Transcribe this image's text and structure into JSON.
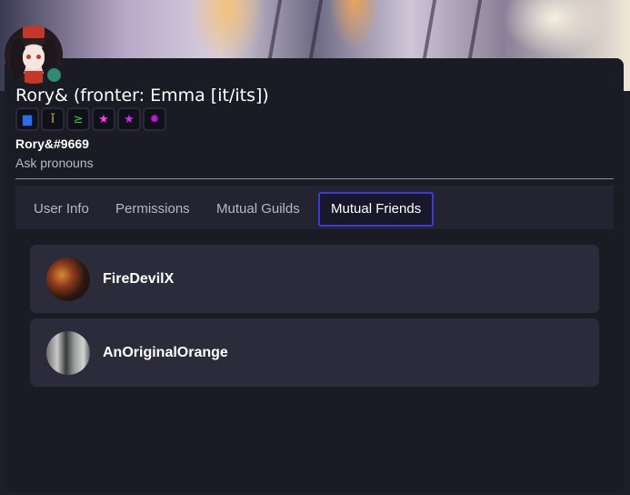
{
  "profile": {
    "display_name": "Rory& (fronter: Emma [it/its])",
    "username": "Rory&#9669",
    "pronouns": "Ask pronouns",
    "status_color": "#2e8b6f",
    "badges": [
      {
        "icon": "blue-box-badge-icon",
        "glyph": "▆",
        "color": "#2d6cf0"
      },
      {
        "icon": "yellow-candle-badge-icon",
        "glyph": "ǐ",
        "color": "#e8c93a"
      },
      {
        "icon": "green-prompt-badge-icon",
        "glyph": "≥",
        "color": "#3ac24a"
      },
      {
        "icon": "pink-star-badge-icon",
        "glyph": "★",
        "color": "#ff3cf0"
      },
      {
        "icon": "magenta-star-badge-icon",
        "glyph": "★",
        "color": "#d12cf0"
      },
      {
        "icon": "purple-burst-badge-icon",
        "glyph": "✸",
        "color": "#c01ae0"
      }
    ]
  },
  "tabs": [
    {
      "label": "User Info",
      "active": false
    },
    {
      "label": "Permissions",
      "active": false
    },
    {
      "label": "Mutual Guilds",
      "active": false
    },
    {
      "label": "Mutual Friends",
      "active": true
    }
  ],
  "mutual_friends": [
    {
      "name": "FireDevilX"
    },
    {
      "name": "AnOriginalOrange"
    }
  ],
  "colors": {
    "accent": "#3b3bd8",
    "panel": "#1b1b26",
    "card": "#2b2b3b"
  }
}
